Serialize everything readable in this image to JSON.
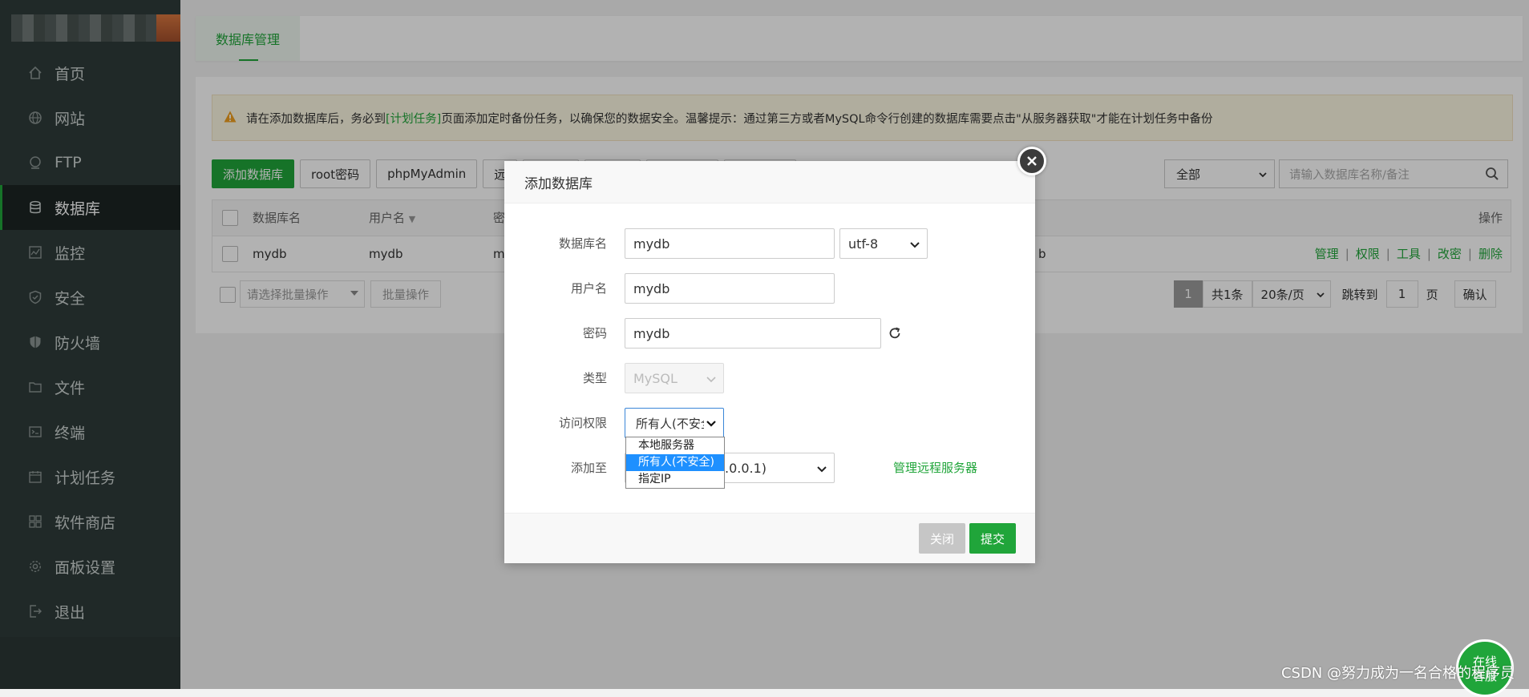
{
  "sidebar": {
    "items": [
      {
        "label": "首页",
        "icon": "home-icon"
      },
      {
        "label": "网站",
        "icon": "globe-icon"
      },
      {
        "label": "FTP",
        "icon": "ftp-icon"
      },
      {
        "label": "数据库",
        "icon": "database-icon",
        "active": true
      },
      {
        "label": "监控",
        "icon": "monitor-icon"
      },
      {
        "label": "安全",
        "icon": "shield-icon"
      },
      {
        "label": "防火墙",
        "icon": "firewall-icon"
      },
      {
        "label": "文件",
        "icon": "folder-icon"
      },
      {
        "label": "终端",
        "icon": "terminal-icon"
      },
      {
        "label": "计划任务",
        "icon": "calendar-icon"
      },
      {
        "label": "软件商店",
        "icon": "apps-icon"
      },
      {
        "label": "面板设置",
        "icon": "gear-icon"
      },
      {
        "label": "退出",
        "icon": "logout-icon"
      }
    ]
  },
  "header": {
    "tab": "数据库管理"
  },
  "alert": {
    "prefix": "请在添加数据库后，务必到",
    "link": "[计划任务]",
    "suffix": "页面添加定时备份任务，以确保您的数据安全。温馨提示：通过第三方或者MySQL命令行创建的数据库需要点击\"从服务器获取\"才能在计划任务中备份"
  },
  "toolbar": {
    "add_db": "添加数据库",
    "root_pwd": "root密码",
    "phpmyadmin": "phpMyAdmin",
    "remote_partial": "远"
  },
  "filter": {
    "value": "全部"
  },
  "search": {
    "placeholder": "请输入数据库名称/备注"
  },
  "table": {
    "headers": {
      "name": "数据库名",
      "user": "用户名",
      "pwd_partial": "密",
      "ops": "操作"
    },
    "rows": [
      {
        "name": "mydb",
        "user": "mydb",
        "pwd_partial": "m",
        "backup_partial": "b"
      }
    ],
    "ops": [
      "管理",
      "权限",
      "工具",
      "改密",
      "删除"
    ]
  },
  "batch": {
    "select": "请选择批量操作",
    "button": "批量操作"
  },
  "pager": {
    "current": "1",
    "total": "共1条",
    "size": "20条/页",
    "jump_label": "跳转到",
    "jump_value": "1",
    "page_unit": "页",
    "confirm": "确认"
  },
  "modal": {
    "title": "添加数据库",
    "db_name_label": "数据库名",
    "db_name": "mydb",
    "charset": "utf-8",
    "user_label": "用户名",
    "user": "mydb",
    "pwd_label": "密码",
    "pwd": "mydb",
    "type_label": "类型",
    "type": "MySQL",
    "access_label": "访问权限",
    "access": "所有人(不安全)",
    "access_options": [
      "本地服务器",
      "所有人(不安全)",
      "指定IP"
    ],
    "add_to_label": "添加至",
    "add_to_partial": ".0.0.1)",
    "manage_remote": "管理远程服务器",
    "cancel": "关闭",
    "submit": "提交"
  },
  "service_badge": {
    "line1": "在线",
    "line2": "客服"
  },
  "watermark": "CSDN @努力成为一名合格的程序员",
  "colors": {
    "accent": "#20a53a",
    "sidebar": "#2f3c3a"
  }
}
